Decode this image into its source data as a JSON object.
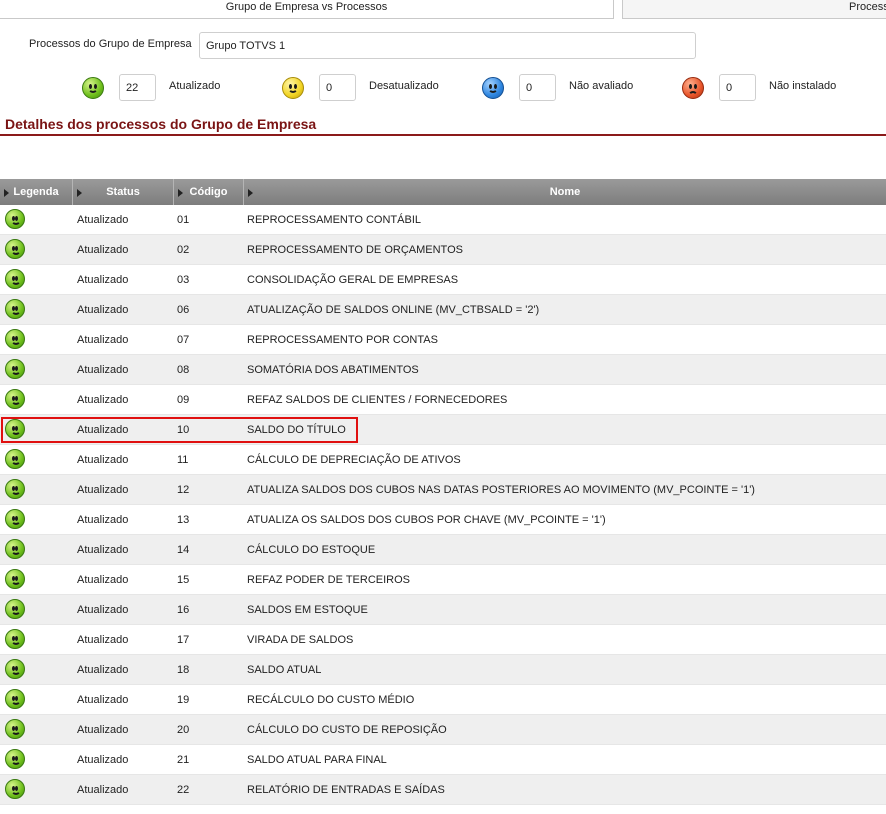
{
  "tabs": [
    {
      "label": "Grupo de Empresa vs Processos"
    },
    {
      "label": "Process"
    }
  ],
  "grupo": {
    "label": "Processos do Grupo de Empresa",
    "value": "Grupo TOTVS 1"
  },
  "counters": [
    {
      "icon": "green-smiley-icon",
      "value": "22",
      "label": "Atualizado"
    },
    {
      "icon": "yellow-smiley-icon",
      "value": "0",
      "label": "Desatualizado"
    },
    {
      "icon": "blue-smiley-icon",
      "value": "0",
      "label": "Não avaliado"
    },
    {
      "icon": "red-sad-face-icon",
      "value": "0",
      "label": "Não instalado"
    }
  ],
  "section_title": "Detalhes dos processos do Grupo de Empresa",
  "grid": {
    "headers": {
      "legenda": "Legenda",
      "status": "Status",
      "codigo": "Código",
      "nome": "Nome"
    },
    "rows": [
      {
        "status": "Atualizado",
        "codigo": "01",
        "nome": "REPROCESSAMENTO CONTÁBIL"
      },
      {
        "status": "Atualizado",
        "codigo": "02",
        "nome": "REPROCESSAMENTO DE ORÇAMENTOS"
      },
      {
        "status": "Atualizado",
        "codigo": "03",
        "nome": "CONSOLIDAÇÃO GERAL DE EMPRESAS"
      },
      {
        "status": "Atualizado",
        "codigo": "06",
        "nome": "ATUALIZAÇÃO DE SALDOS ONLINE (MV_CTBSALD = '2')"
      },
      {
        "status": "Atualizado",
        "codigo": "07",
        "nome": "REPROCESSAMENTO POR CONTAS"
      },
      {
        "status": "Atualizado",
        "codigo": "08",
        "nome": "SOMATÓRIA DOS ABATIMENTOS"
      },
      {
        "status": "Atualizado",
        "codigo": "09",
        "nome": "REFAZ SALDOS DE CLIENTES / FORNECEDORES"
      },
      {
        "status": "Atualizado",
        "codigo": "10",
        "nome": "SALDO DO TÍTULO"
      },
      {
        "status": "Atualizado",
        "codigo": "11",
        "nome": "CÁLCULO DE DEPRECIAÇÃO DE ATIVOS"
      },
      {
        "status": "Atualizado",
        "codigo": "12",
        "nome": "ATUALIZA SALDOS DOS CUBOS NAS DATAS POSTERIORES AO MOVIMENTO (MV_PCOINTE = '1')"
      },
      {
        "status": "Atualizado",
        "codigo": "13",
        "nome": "ATUALIZA OS SALDOS DOS CUBOS POR CHAVE (MV_PCOINTE = '1')"
      },
      {
        "status": "Atualizado",
        "codigo": "14",
        "nome": "CÁLCULO DO ESTOQUE"
      },
      {
        "status": "Atualizado",
        "codigo": "15",
        "nome": "REFAZ PODER DE TERCEIROS"
      },
      {
        "status": "Atualizado",
        "codigo": "16",
        "nome": "SALDOS EM ESTOQUE"
      },
      {
        "status": "Atualizado",
        "codigo": "17",
        "nome": "VIRADA DE SALDOS"
      },
      {
        "status": "Atualizado",
        "codigo": "18",
        "nome": "SALDO ATUAL"
      },
      {
        "status": "Atualizado",
        "codigo": "19",
        "nome": "RECÁLCULO DO CUSTO MÉDIO"
      },
      {
        "status": "Atualizado",
        "codigo": "20",
        "nome": "CÁLCULO DO CUSTO DE REPOSIÇÃO"
      },
      {
        "status": "Atualizado",
        "codigo": "21",
        "nome": "SALDO ATUAL PARA FINAL"
      },
      {
        "status": "Atualizado",
        "codigo": "22",
        "nome": "RELATÓRIO DE ENTRADAS E SAÍDAS"
      }
    ]
  },
  "colors": {
    "accent": "#8b1a1a",
    "highlight": "#e01010"
  }
}
